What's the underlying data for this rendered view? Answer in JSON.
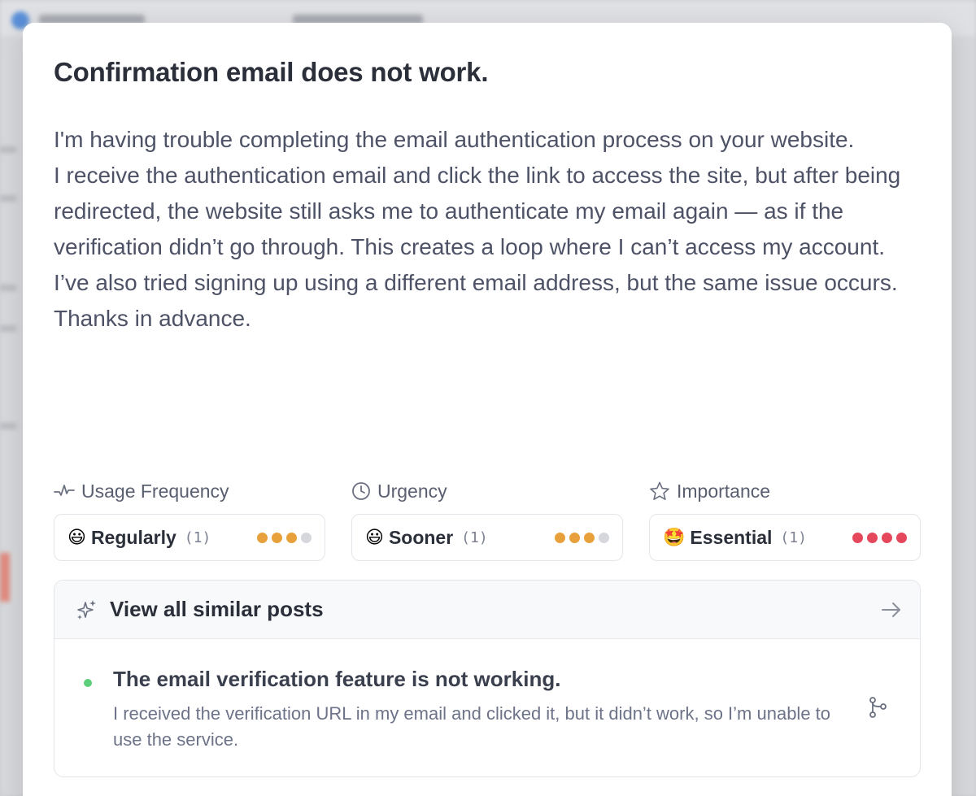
{
  "modal": {
    "title": "Confirmation email does not work.",
    "description": [
      "I'm having trouble completing the email authentication process on your website.",
      "I receive the authentication email and click the link to access the site, but after being redirected, the website still asks me to authenticate my email again — as if the verification didn’t go through. This creates a loop where I can’t access my account.",
      "I’ve also tried signing up using a different email address, but the same issue occurs. Thanks in advance."
    ]
  },
  "metrics": [
    {
      "label": "Usage Frequency",
      "icon": "activity-icon",
      "emoji": "😃",
      "value": "Regularly",
      "count": "(1)",
      "level": 3,
      "max": 4,
      "color": "#e8a13a"
    },
    {
      "label": "Urgency",
      "icon": "clock-icon",
      "emoji": "😃",
      "value": "Sooner",
      "count": "(1)",
      "level": 3,
      "max": 4,
      "color": "#e8a13a"
    },
    {
      "label": "Importance",
      "icon": "star-icon",
      "emoji": "🤩",
      "value": "Essential",
      "count": "(1)",
      "level": 4,
      "max": 4,
      "color": "#e5485d"
    }
  ],
  "similar": {
    "header_label": "View all similar posts",
    "items": [
      {
        "title": "The email verification feature is not working.",
        "description": "I received the verification URL in my email and clicked it, but it didn’t work, so I’m unable to use the service.",
        "status_color": "#5ccf7a"
      }
    ]
  },
  "colors": {
    "dot_inactive": "#d5d7dd"
  }
}
